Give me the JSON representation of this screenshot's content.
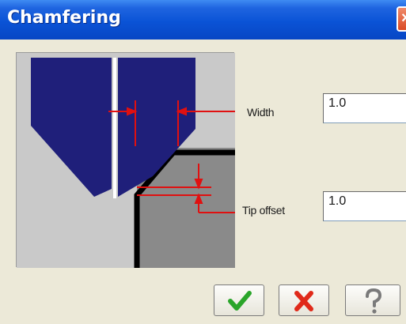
{
  "window": {
    "title": "Chamfering"
  },
  "fields": {
    "width": {
      "label": "Width",
      "value": "1.0"
    },
    "tip_offset": {
      "label": "Tip offset",
      "value": "1.0"
    }
  },
  "buttons": {
    "ok_icon": "check-icon",
    "cancel_icon": "cross-icon",
    "help_icon": "question-icon"
  },
  "colors": {
    "titlebar": "#0a53d6",
    "tool": "#1f1f7a",
    "dimension": "#e01010",
    "ok": "#2aa52a",
    "cancel": "#e02a1a"
  }
}
